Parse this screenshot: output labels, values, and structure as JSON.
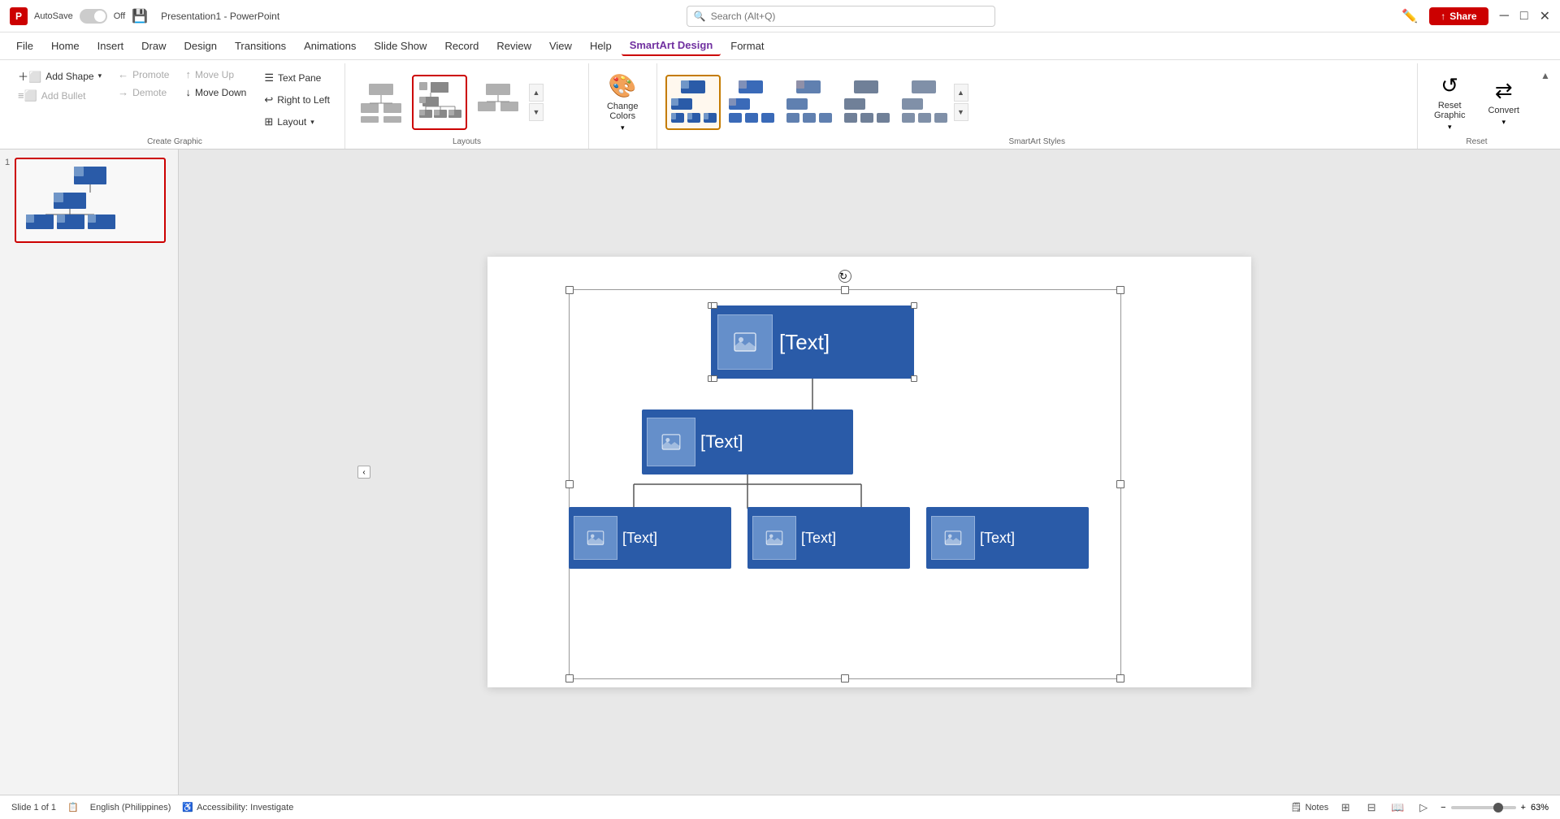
{
  "app": {
    "icon": "P",
    "autosave_label": "AutoSave",
    "toggle_state": "Off",
    "title": "Presentation1 - PowerPoint",
    "search_placeholder": "Search (Alt+Q)"
  },
  "titlebar": {
    "minimize": "─",
    "maximize": "□",
    "close": "✕",
    "share_label": "Share"
  },
  "menu": {
    "items": [
      "File",
      "Home",
      "Insert",
      "Draw",
      "Design",
      "Transitions",
      "Animations",
      "Slide Show",
      "Record",
      "Review",
      "View",
      "Help",
      "SmartArt Design",
      "Format"
    ]
  },
  "ribbon": {
    "groups": {
      "create_graphic": {
        "label": "Create Graphic",
        "add_shape": "Add Shape",
        "add_bullet": "Add Bullet",
        "promote": "Promote",
        "demote": "Demote",
        "move_up": "Move Up",
        "move_down": "Move Down",
        "text_pane": "Text Pane",
        "right_to_left": "Right to Left",
        "layout": "Layout"
      },
      "layouts": {
        "label": "Layouts"
      },
      "smartart_styles": {
        "label": "SmartArt Styles"
      },
      "change_colors": {
        "label": "Change Colors",
        "button": "Change Colors"
      },
      "reset": {
        "label": "Reset",
        "reset_graphic": "Reset Graphic",
        "convert": "Convert"
      }
    }
  },
  "canvas": {
    "boxes": {
      "level1": "[Text]",
      "level2": "[Text]",
      "level3a": "[Text]",
      "level3b": "[Text]",
      "level3c": "[Text]"
    }
  },
  "statusbar": {
    "slide_info": "Slide 1 of 1",
    "language": "English (Philippines)",
    "accessibility": "Accessibility: Investigate",
    "notes": "Notes",
    "zoom": "63%"
  }
}
